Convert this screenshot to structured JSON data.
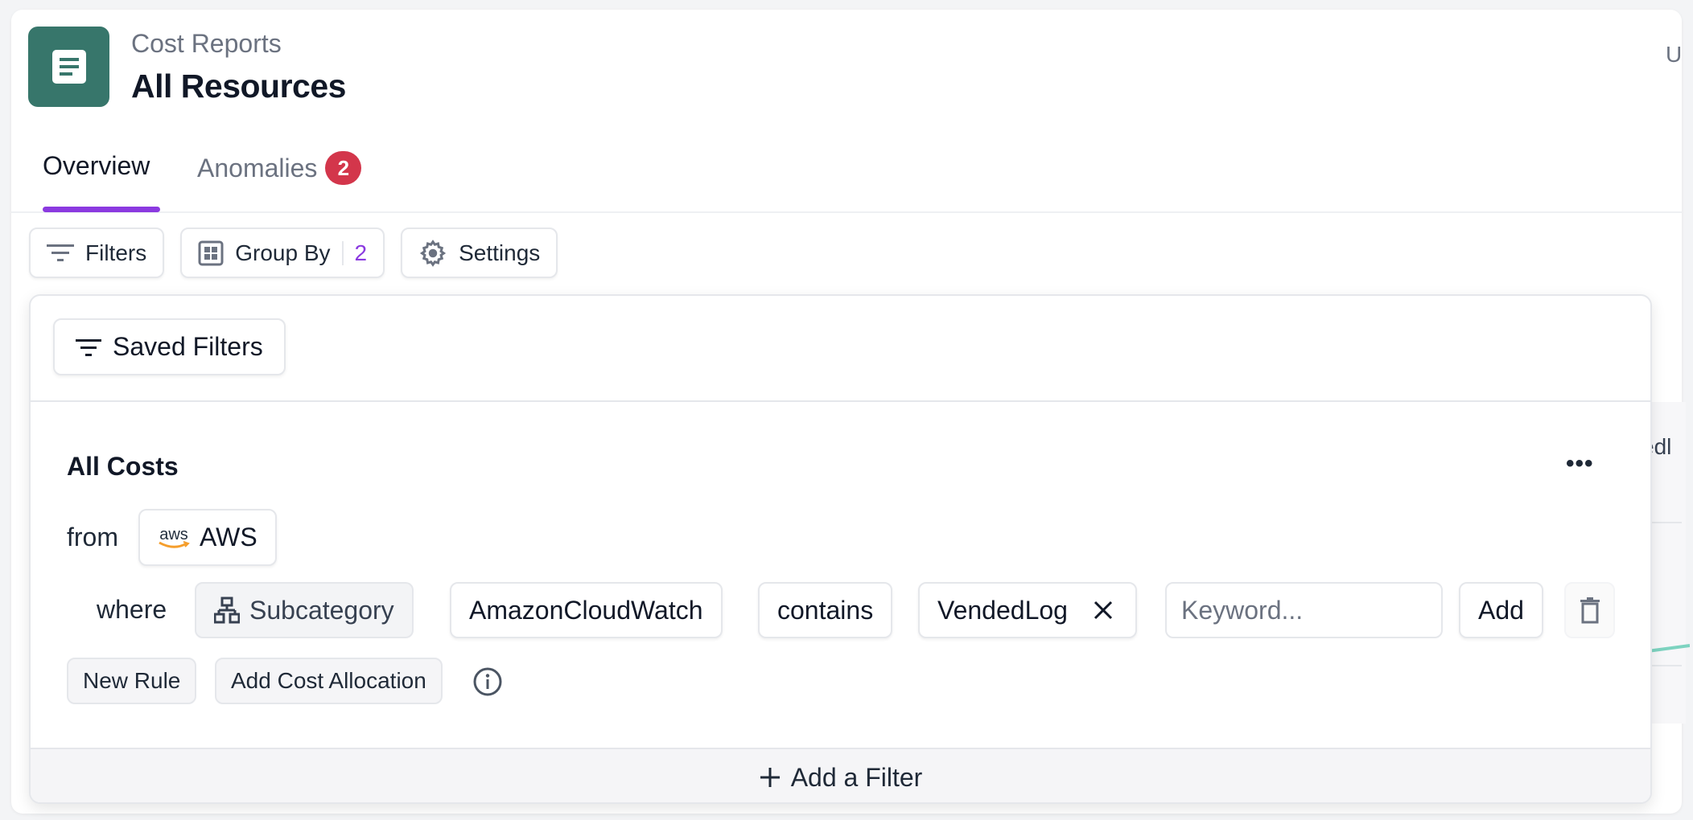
{
  "header": {
    "breadcrumb": "Cost Reports",
    "title": "All Resources",
    "icon": "report-document-icon",
    "icon_color": "#37766b",
    "right_peek_text": "U"
  },
  "tabs": [
    {
      "label": "Overview",
      "active": true
    },
    {
      "label": "Anomalies",
      "active": false,
      "badge": "2"
    }
  ],
  "accent_color": "#8b3ae0",
  "badge_color": "#d3364b",
  "toolbar": {
    "filters_label": "Filters",
    "group_by_label": "Group By",
    "group_by_count": "2",
    "settings_label": "Settings"
  },
  "background_peek": {
    "text": "edl"
  },
  "filter_panel": {
    "saved_filters_label": "Saved Filters",
    "group_title": "All Costs",
    "more_label": "•••",
    "from_label": "from",
    "source": {
      "logo_text": "aws",
      "label": "AWS"
    },
    "where_label": "where",
    "rule": {
      "field": "Subcategory",
      "value": "AmazonCloudWatch",
      "operator": "contains",
      "keywords": [
        "VendedLog"
      ],
      "keyword_placeholder": "Keyword...",
      "keyword_value": "",
      "add_label": "Add"
    },
    "new_rule_label": "New Rule",
    "add_cost_allocation_label": "Add Cost Allocation",
    "add_filter_label": "Add a Filter"
  }
}
